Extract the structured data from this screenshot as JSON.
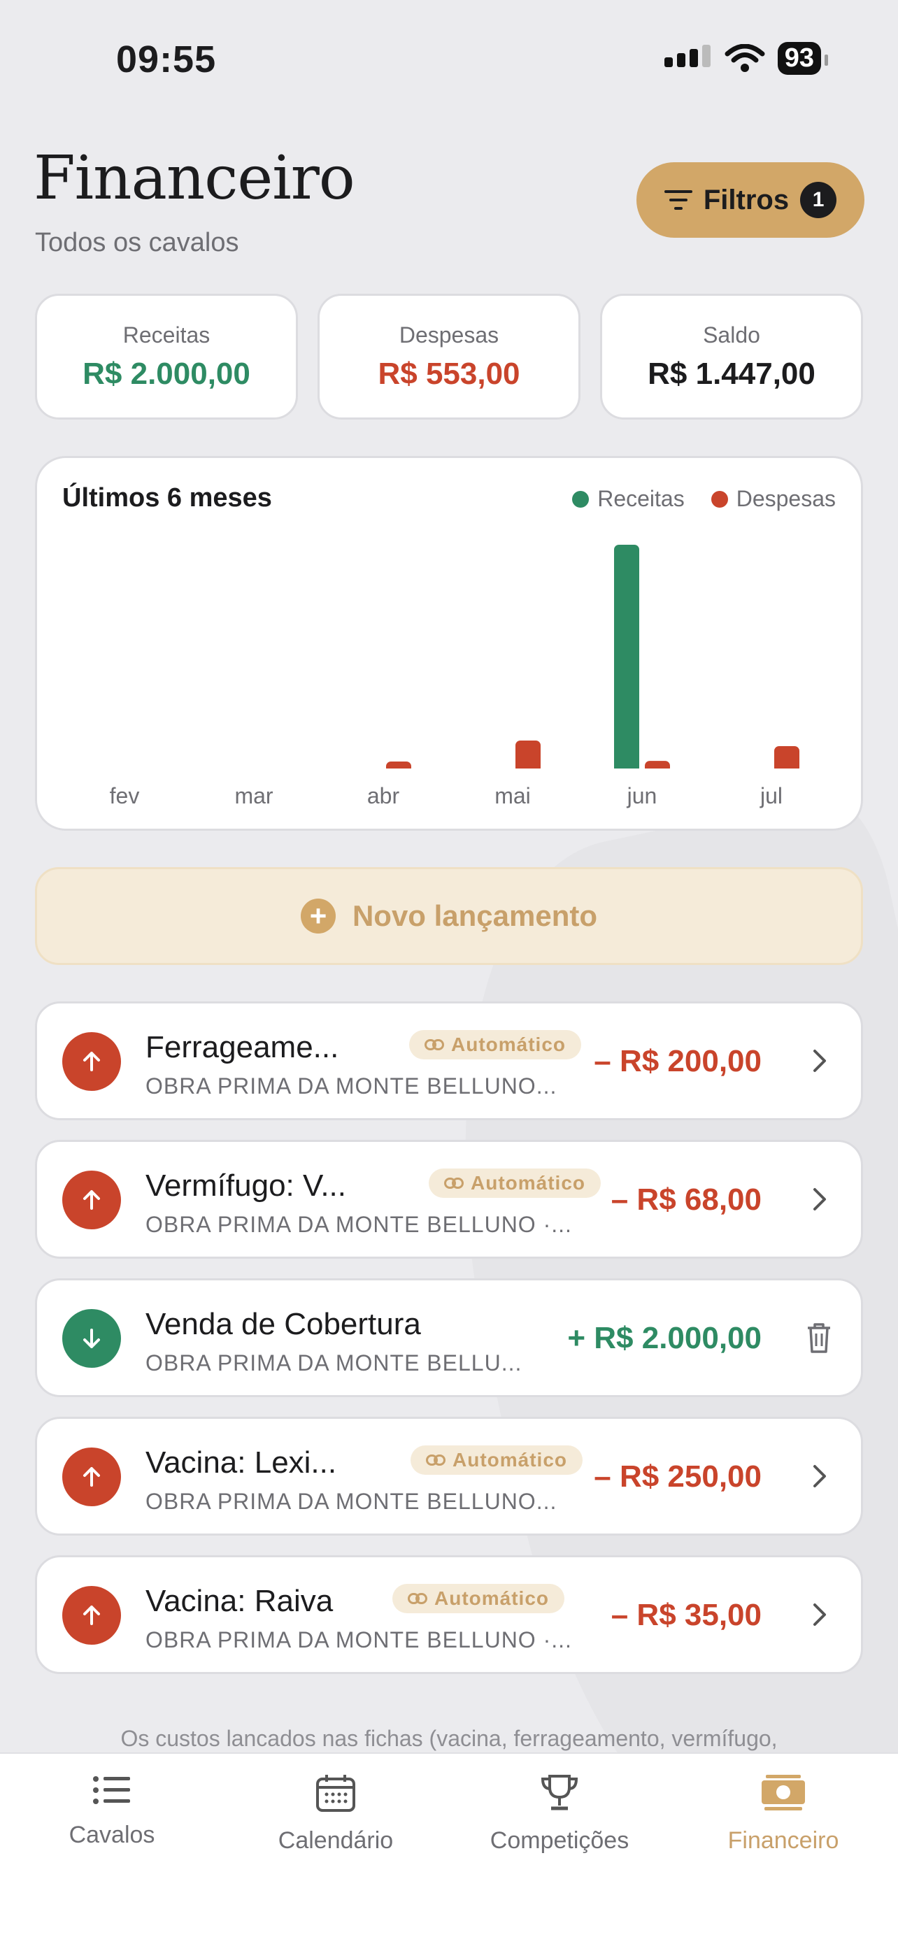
{
  "status_bar": {
    "time": "09:55",
    "battery": "93"
  },
  "header": {
    "title": "Financeiro",
    "subtitle": "Todos os cavalos",
    "filters_label": "Filtros",
    "filters_count": "1"
  },
  "summary": {
    "income_label": "Receitas",
    "income_value": "R$ 2.000,00",
    "expense_label": "Despesas",
    "expense_value": "R$ 553,00",
    "balance_label": "Saldo",
    "balance_value": "R$ 1.447,00"
  },
  "colors": {
    "income": "#2e8b63",
    "expense": "#c9442b",
    "accent": "#d2a768"
  },
  "chart_data": {
    "type": "bar",
    "title": "Últimos 6 meses",
    "categories": [
      "fev",
      "mar",
      "abr",
      "mai",
      "jun",
      "jul"
    ],
    "series": [
      {
        "name": "Receitas",
        "values": [
          0,
          0,
          0,
          0,
          2000,
          0
        ]
      },
      {
        "name": "Despesas",
        "values": [
          0,
          0,
          35,
          250,
          68,
          200
        ]
      }
    ],
    "ylim": [
      0,
      2000
    ],
    "legend": "top-right",
    "grid": false
  },
  "new_entry_label": "Novo lançamento",
  "transactions": [
    {
      "title": "Ferrageame...",
      "tag": "Automático",
      "subtitle": "OBRA PRIMA DA MONTE BELLUNO...",
      "amount": "– R$ 200,00",
      "direction": "out",
      "action": "chevron"
    },
    {
      "title": "Vermífugo: V...",
      "tag": "Automático",
      "subtitle": "OBRA PRIMA DA MONTE BELLUNO ·...",
      "amount": "– R$ 68,00",
      "direction": "out",
      "action": "chevron"
    },
    {
      "title": "Venda de Cobertura",
      "tag": "",
      "subtitle": "OBRA PRIMA DA MONTE BELLU...",
      "amount": "+ R$ 2.000,00",
      "direction": "in",
      "action": "trash"
    },
    {
      "title": "Vacina: Lexi...",
      "tag": "Automático",
      "subtitle": "OBRA PRIMA DA MONTE BELLUNO...",
      "amount": "– R$ 250,00",
      "direction": "out",
      "action": "chevron"
    },
    {
      "title": "Vacina: Raiva",
      "tag": "Automático",
      "subtitle": "OBRA PRIMA DA MONTE BELLUNO ·...",
      "amount": "– R$ 35,00",
      "direction": "out",
      "action": "chevron"
    }
  ],
  "footnote": "Os custos lancados nas fichas (vacina, ferrageamento, vermífugo,",
  "tabbar": {
    "tab1": "Cavalos",
    "tab2": "Calendário",
    "tab3": "Competições",
    "tab4": "Financeiro"
  }
}
